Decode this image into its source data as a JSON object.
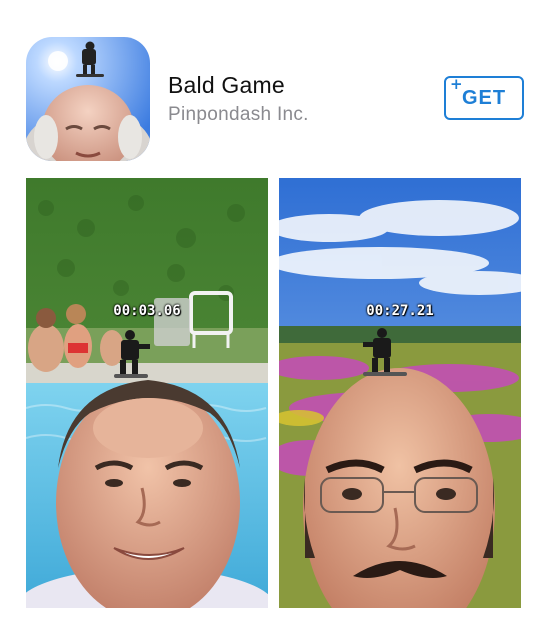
{
  "app": {
    "title": "Bald Game",
    "developer": "Pinpondash Inc.",
    "get_label": "GET",
    "get_plus": "+",
    "icon": "bald-head-with-snowboarder-icon"
  },
  "screenshots": [
    {
      "timer": "00:03.06"
    },
    {
      "timer": "00:27.21"
    }
  ],
  "colors": {
    "accent": "#1e7fd6",
    "title_text": "#111111",
    "developer_text": "#8a8a8f"
  }
}
